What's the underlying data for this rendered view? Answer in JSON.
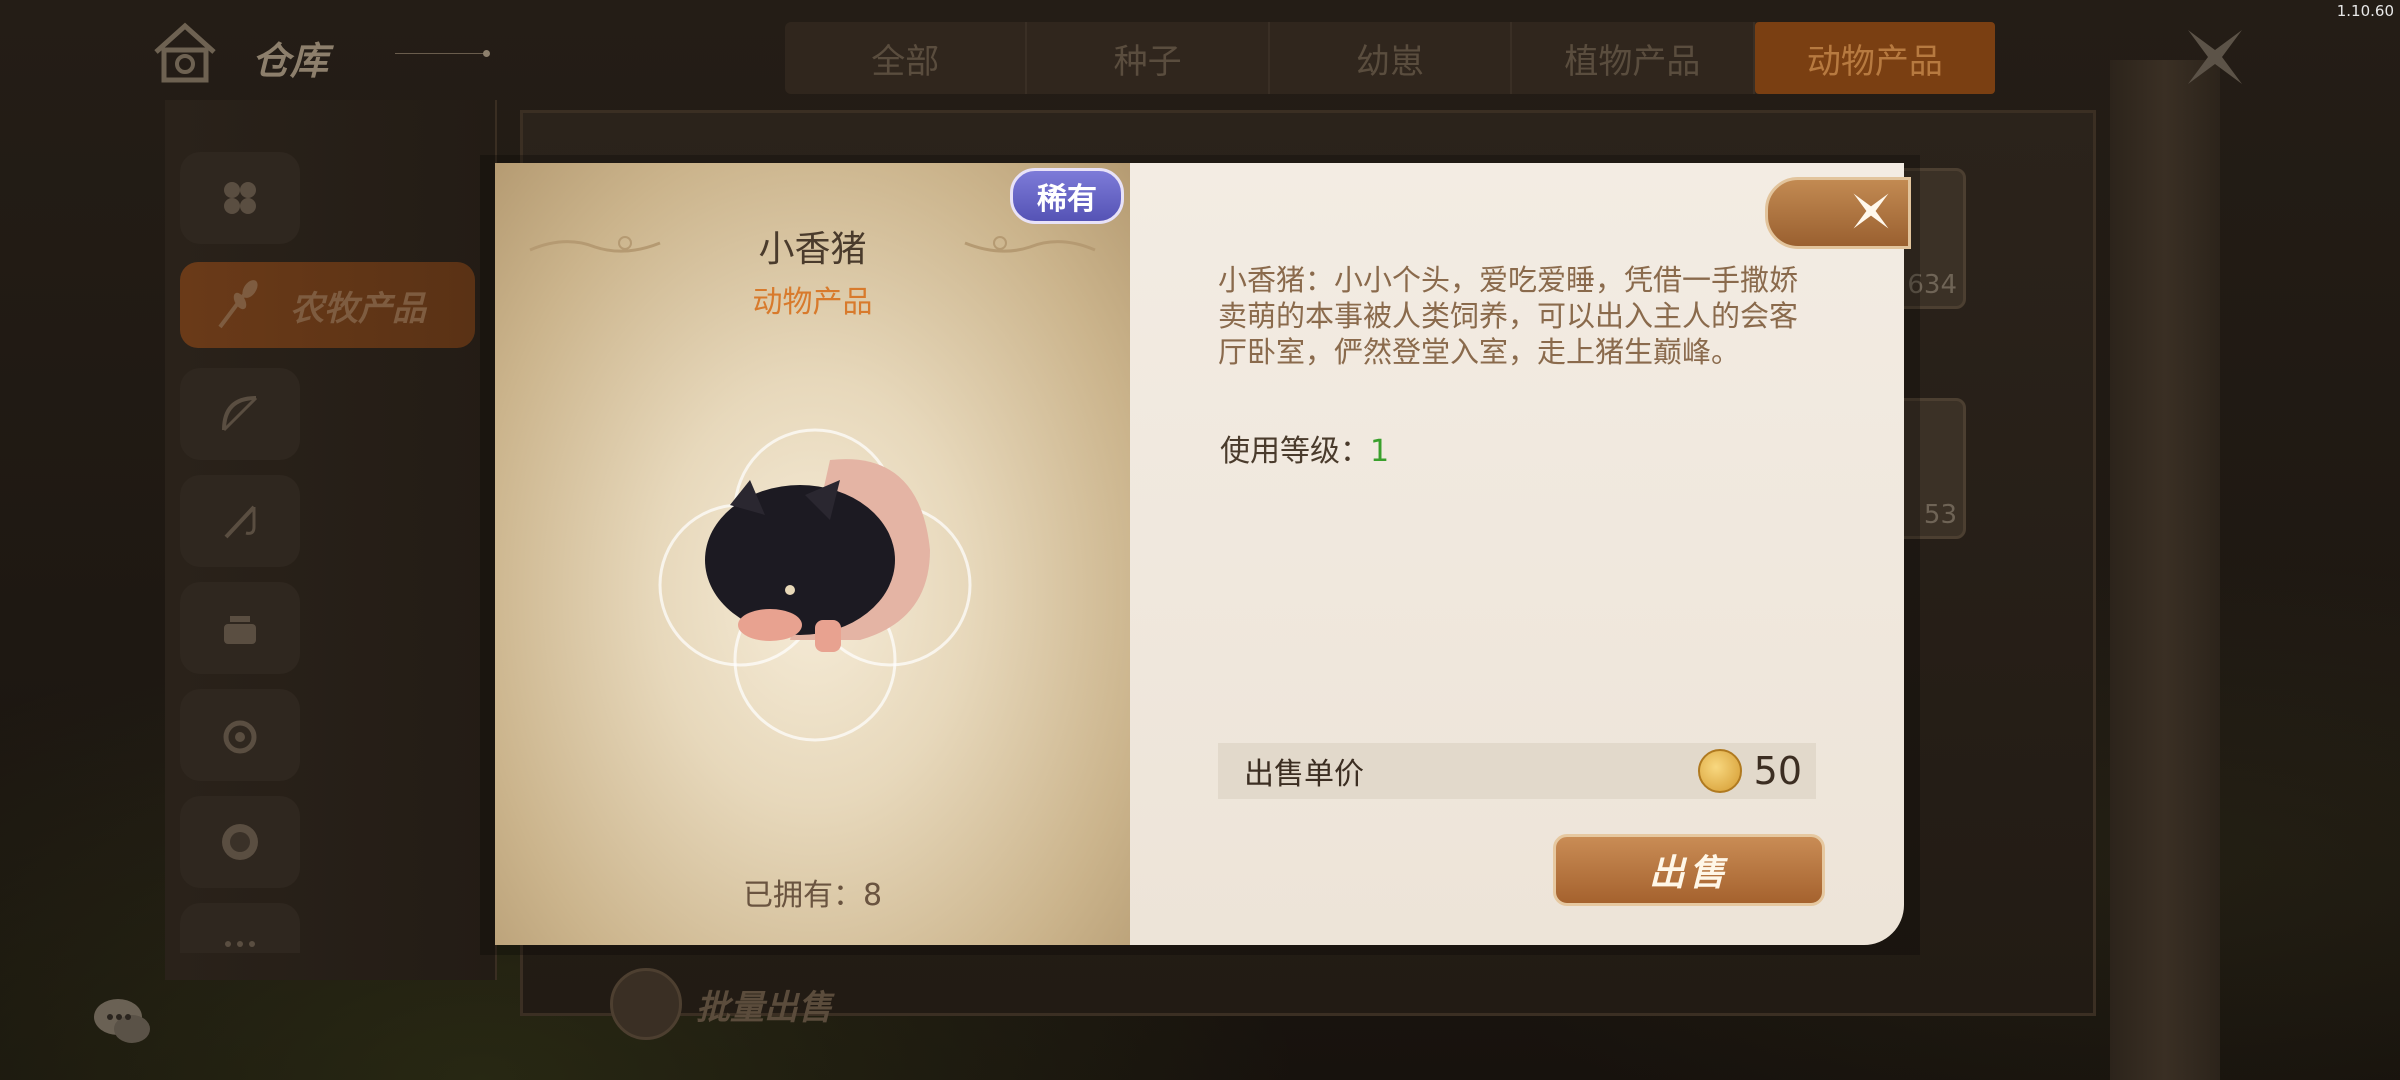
{
  "version": "1.10.60",
  "header": {
    "title": "仓库",
    "tabs": [
      "全部",
      "种子",
      "幼崽",
      "植物产品",
      "动物产品"
    ],
    "active_tab_index": 4
  },
  "sidebar": {
    "active_label": "农牧产品",
    "icons": [
      "grid-icon",
      "bow-icon",
      "fishing-rod-icon",
      "pot-icon",
      "swirl-icon",
      "mask-icon",
      "more-icon"
    ]
  },
  "background_items": [
    {
      "count": "634"
    },
    {
      "count": "53"
    }
  ],
  "bulk_sell_label": "批量出售",
  "modal": {
    "rarity": "稀有",
    "name": "小香猪",
    "category": "动物产品",
    "owned_text": "已拥有：8",
    "description": "小香猪：小小个头，爱吃爱睡，凭借一手撒娇卖萌的本事被人类饲养，可以出入主人的会客厅卧室，俨然登堂入室，走上猪生巅峰。",
    "level_label": "使用等级：",
    "level_value": "1",
    "price_label": "出售单价",
    "price_value": "50",
    "sell_button": "出售"
  },
  "colors": {
    "accent_orange": "#d87a2c",
    "rarity_purple": "#6a68c8",
    "level_green": "#3aa02c",
    "button_brown": "#b0703a"
  }
}
